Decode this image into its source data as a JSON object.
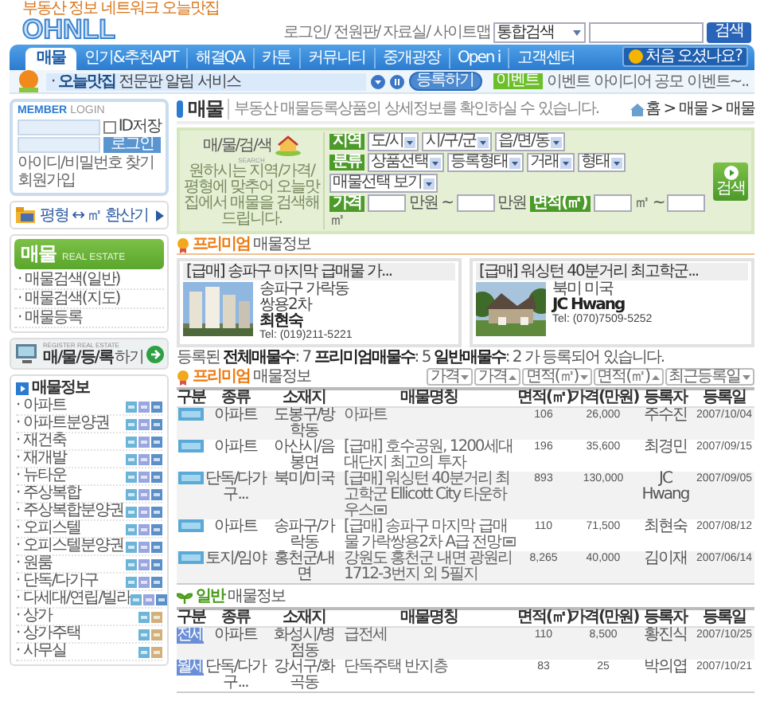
{
  "header": {
    "tagline": "부동산 정보 네트워크 오늘맛집",
    "logo": "OHNLL",
    "links": [
      "로그인/",
      "전원판/",
      "자료실/",
      "사이트맵"
    ],
    "search": {
      "scope": "통합검색",
      "button": "검색"
    }
  },
  "nav": {
    "tabs": [
      {
        "label": "매물",
        "selected": true
      },
      {
        "label": "인기&추천APT",
        "selected": false
      },
      {
        "label": "해결QA",
        "selected": false
      },
      {
        "label": "카툰",
        "selected": false
      },
      {
        "label": "커뮤니티",
        "selected": false
      },
      {
        "label": "중개광장",
        "selected": false
      },
      {
        "label": "Open i",
        "selected": false
      },
      {
        "label": "고객센터",
        "selected": false
      }
    ],
    "help_button": "처음 오셨나요?"
  },
  "notice": {
    "text": "· **오늘맛집** 전문판 알림 서비스",
    "register_button": "등록하기",
    "event_badge": "이벤트",
    "event_text": "이벤트 아이디어 공모 이벤트~.."
  },
  "sidebar": {
    "login": {
      "title": "**MEMBER** LOGIN",
      "remember": {
        "label": "ID저장",
        "checked": false
      },
      "button": "로그인",
      "links": [
        "아이디/비밀번호 찾기",
        "회원가입"
      ]
    },
    "converter": "평형 ↔ ㎡ 환산기",
    "menu": {
      "title": "매물",
      "subtitle": "REAL ESTATE",
      "items": [
        "· 매물검색(일반)",
        "· 매물검색(지도)",
        "· 매물등록"
      ]
    },
    "register_banner": {
      "caption": "REGISTER REAL ESTATE",
      "title": "매/물/등/록",
      "suffix": "하기"
    },
    "info": {
      "title": "매물정보",
      "items": [
        {
          "label": "· 아파트",
          "kind": "residential"
        },
        {
          "label": "· 아파트분양권",
          "kind": "residential"
        },
        {
          "label": "· 재건축",
          "kind": "residential"
        },
        {
          "label": "· 재개발",
          "kind": "residential"
        },
        {
          "label": "· 뉴타운",
          "kind": "residential"
        },
        {
          "label": "· 주상복합",
          "kind": "residential"
        },
        {
          "label": "· 주상복합분양권",
          "kind": "residential"
        },
        {
          "label": "· 오피스텔",
          "kind": "residential"
        },
        {
          "label": "· 오피스텔분양권",
          "kind": "residential"
        },
        {
          "label": "· 원룸",
          "kind": "residential"
        },
        {
          "label": "· 단독/다가구",
          "kind": "residential"
        },
        {
          "label": "· 다세대/연립/빌라",
          "kind": "residential"
        },
        {
          "label": "· 상가",
          "kind": "commercial"
        },
        {
          "label": "· 상가주택",
          "kind": "commercial"
        },
        {
          "label": "· 사무실",
          "kind": "commercial"
        }
      ]
    }
  },
  "main": {
    "title": "매물",
    "description": "부동산 매물등록상품의 상세정보를 확인하실 수 있습니다.",
    "breadcrumb": "홈 > 매물 > 매물",
    "search": {
      "title": "매/물/검/색",
      "subtitle": "SEARCH",
      "blurb": "원하시는 지역/가격/평형에 맞추어 오늘맛집에서 매물을 검색해 드립니다.",
      "button": "검색",
      "rows": [
        {
          "label": "지역",
          "fields": [
            {
              "kind": "select",
              "text": "도/시"
            },
            {
              "kind": "select",
              "text": "시/구/군"
            },
            {
              "kind": "select",
              "text": "읍/면/동"
            }
          ]
        },
        {
          "label": "분류",
          "fields": [
            {
              "kind": "select",
              "text": "상품선택"
            },
            {
              "kind": "select",
              "text": "등록형태"
            },
            {
              "kind": "select",
              "text": "거래"
            },
            {
              "kind": "select",
              "text": "형태"
            },
            {
              "kind": "select",
              "text": "매물선택 보기"
            }
          ]
        },
        {
          "label": "가격",
          "fields": [
            {
              "kind": "input"
            },
            {
              "kind": "unit",
              "text": "만원 ~"
            },
            {
              "kind": "input"
            },
            {
              "kind": "unit",
              "text": "만원"
            },
            {
              "kind": "label",
              "text": "면적(㎡)"
            },
            {
              "kind": "input"
            },
            {
              "kind": "unit",
              "text": "㎡ ~"
            },
            {
              "kind": "input"
            },
            {
              "kind": "unit",
              "text": "㎡"
            }
          ]
        }
      ]
    },
    "premium_heading": {
      "accent": "프리미엄",
      "text": "매물정보"
    },
    "cards": [
      {
        "title": "[급매] 송파구 마지막 급매물 가...",
        "lines": [
          "송파구 가락동",
          "쌍용2차"
        ],
        "agent": "최현숙",
        "tel": "Tel: (019)211-5221"
      },
      {
        "title": "[급매] 워싱턴 40분거리 최고학군...",
        "lines": [
          "북미 미국"
        ],
        "agent": "JC Hwang",
        "tel": "Tel: (070)7509-5252"
      }
    ],
    "count": "등록된 **전체매물수**: 7 **프리미엄매물수**: 5 **일반매물수**: 2 가 등록되어 있습니다.",
    "premium_list_heading": {
      "accent": "프리미엄",
      "text": "매물정보"
    },
    "sort_buttons": [
      {
        "label": "가격",
        "ascending": false
      },
      {
        "label": "가격",
        "ascending": true
      },
      {
        "label": "면적(㎡)",
        "ascending": false
      },
      {
        "label": "면적(㎡)",
        "ascending": true
      },
      {
        "label": "최근등록일",
        "ascending": false
      }
    ],
    "columns": [
      "구분",
      "종류",
      "소재지",
      "매물명칭",
      "면적(㎡)",
      "가격(만원)",
      "등록자",
      "등록일"
    ],
    "premium_rows": [
      {
        "type": "아파트",
        "location": "도봉구/방학동",
        "name": "아파트",
        "photo": false,
        "area": "106",
        "price": "26,000",
        "agent": "주수진",
        "date": "2007/10/04"
      },
      {
        "type": "아파트",
        "location": "아산시/음봉면",
        "name": "[급매] 호수공원, 1200세대 대단지 최고의 투자",
        "photo": false,
        "area": "196",
        "price": "35,600",
        "agent": "최경민",
        "date": "2007/09/15"
      },
      {
        "type": "단독/다가구...",
        "location": "북미/미국",
        "name": "[급매] 워싱턴 40분거리 최고학군 Ellicott City 타운하우스",
        "photo": true,
        "area": "893",
        "price": "130,000",
        "agent": "JC Hwang",
        "date": "2007/09/05"
      },
      {
        "type": "아파트",
        "location": "송파구/가락동",
        "name": "[급매] 송파구 마지막 급매물 가락쌍용2차 A급 전망",
        "photo": true,
        "area": "110",
        "price": "71,500",
        "agent": "최현숙",
        "date": "2007/08/12"
      },
      {
        "type": "토지/임야",
        "location": "홍천군/내면",
        "name": "강원도 홍천군 내면 광원리 1712-3번지 외 5필지",
        "photo": false,
        "area": "8,265",
        "price": "40,000",
        "agent": "김이재",
        "date": "2007/06/14"
      }
    ],
    "general_heading": {
      "accent": "일반",
      "text": "매물정보"
    },
    "general_columns": [
      "구분",
      "종류",
      "소재지",
      "매물명칭",
      "면적(㎡)",
      "가격(만원)",
      "등록자",
      "등록일"
    ],
    "general_rows": [
      {
        "deal": "전세",
        "type": "아파트",
        "location": "화성시/병점동",
        "name": "급전세",
        "area": "110",
        "price": "8,500",
        "agent": "황진식",
        "date": "2007/10/25"
      },
      {
        "deal": "월세",
        "type": "단독/다가구...",
        "location": "강서구/화곡동",
        "name": "단독주택 반지층",
        "area": "83",
        "price": "25",
        "agent": "박의엽",
        "date": "2007/10/21"
      }
    ]
  }
}
